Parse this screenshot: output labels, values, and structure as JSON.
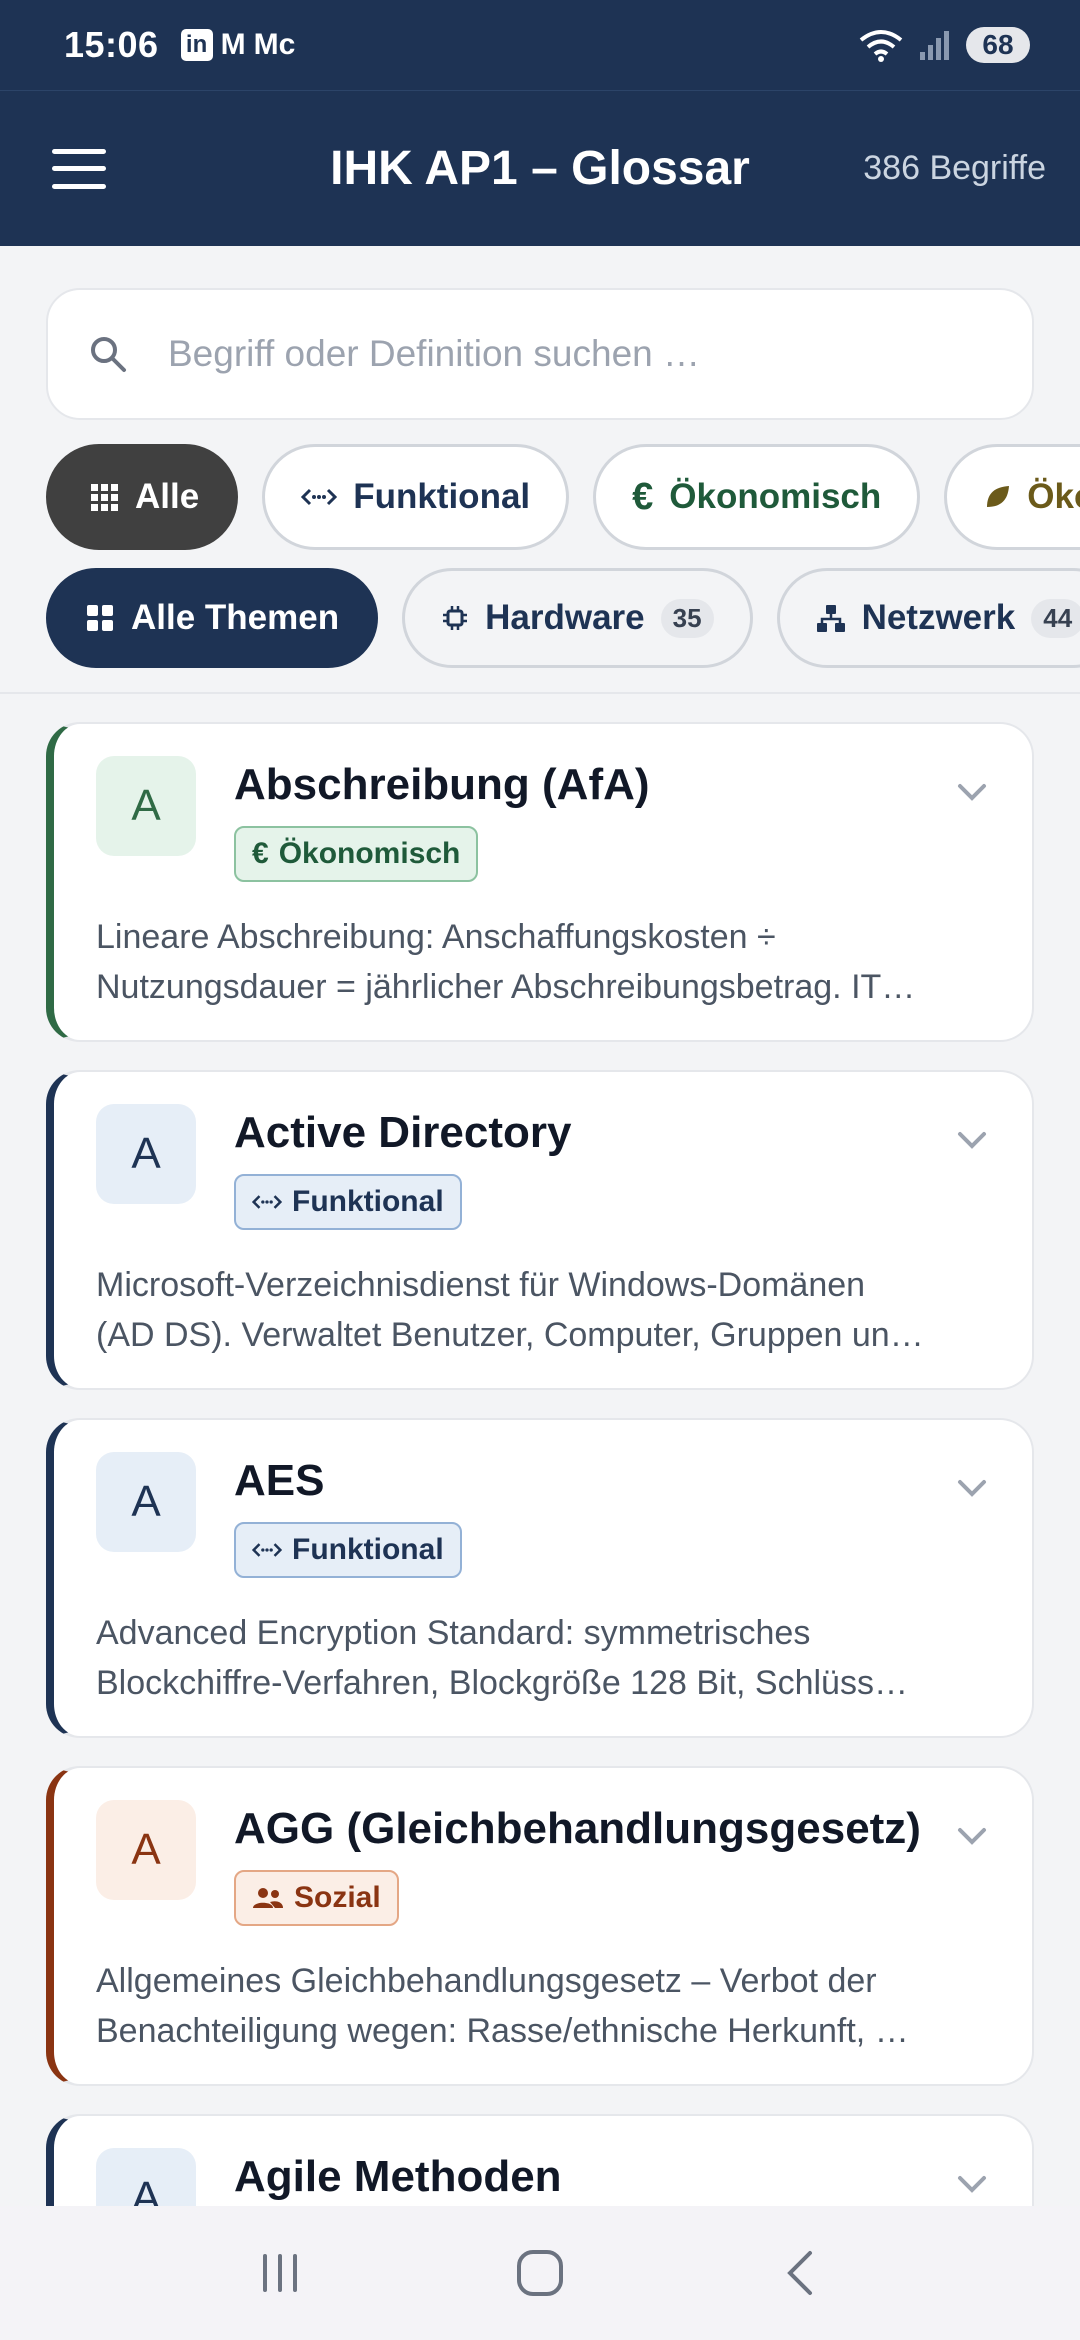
{
  "status": {
    "time": "15:06",
    "battery": "68",
    "notif_m": "M",
    "notif_mc": "Mc"
  },
  "header": {
    "title": "IHK AP1 – Glossar",
    "count": "386 Begriffe"
  },
  "search": {
    "placeholder": "Begriff oder Definition suchen …"
  },
  "filters": [
    {
      "label": "Alle",
      "icon": "grid-icon"
    },
    {
      "label": "Funktional",
      "icon": "code-icon"
    },
    {
      "label": "Ökonomisch",
      "icon": "euro-icon"
    },
    {
      "label": "Ökol",
      "icon": "leaf-icon"
    }
  ],
  "topics": [
    {
      "label": "Alle Themen",
      "icon": "apps-icon"
    },
    {
      "label": "Hardware",
      "count": "35",
      "icon": "chip-icon"
    },
    {
      "label": "Netzwerk",
      "count": "44",
      "icon": "network-icon"
    }
  ],
  "cards": [
    {
      "letter": "A",
      "title": "Abschreibung (AfA)",
      "tag": "Ökonomisch",
      "tag_icon": "euro-icon",
      "line1": "Lineare Abschreibung: Anschaffungskosten ÷",
      "line2": "Nutzungsdauer = jährlicher Abschreibungsbetrag. IT…"
    },
    {
      "letter": "A",
      "title": "Active Directory",
      "tag": "Funktional",
      "tag_icon": "code-icon",
      "line1": "Microsoft-Verzeichnisdienst für Windows-Domänen",
      "line2": "(AD DS). Verwaltet Benutzer, Computer, Gruppen un…"
    },
    {
      "letter": "A",
      "title": "AES",
      "tag": "Funktional",
      "tag_icon": "code-icon",
      "line1": "Advanced Encryption Standard: symmetrisches",
      "line2": "Blockchiffre-Verfahren, Blockgröße 128 Bit, Schlüss…"
    },
    {
      "letter": "A",
      "title": "AGG (Gleichbehandlungsgesetz)",
      "tag": "Sozial",
      "tag_icon": "people-icon",
      "line1": "Allgemeines Gleichbehandlungsgesetz – Verbot der",
      "line2": "Benachteiligung wegen: Rasse/ethnische Herkunft, …"
    },
    {
      "letter": "A",
      "title": "Agile Methoden"
    }
  ],
  "colors": {
    "primary": "#1e3354",
    "eco": "#2f6a45",
    "social": "#8a3412",
    "chip_dark": "#404040"
  }
}
